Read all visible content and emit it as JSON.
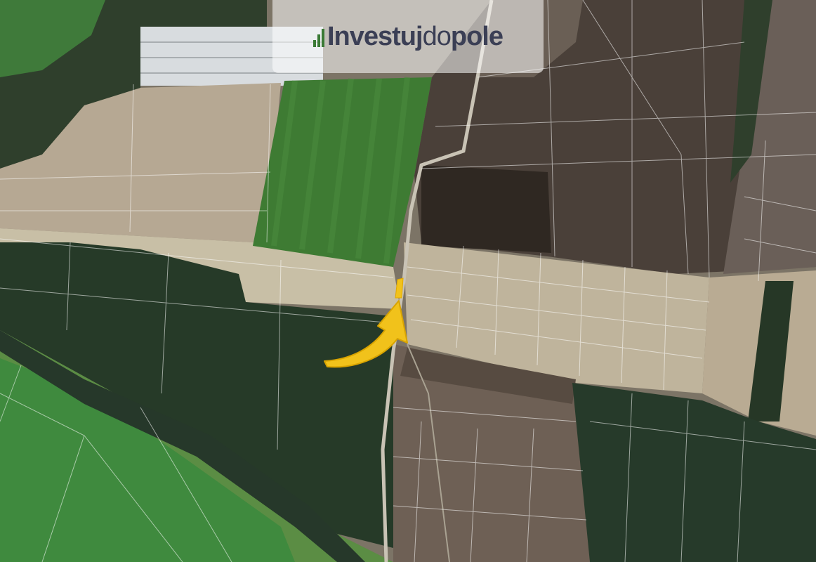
{
  "watermark": {
    "brand_part1": "Investuj",
    "brand_part2": "do",
    "brand_part3": "pole"
  },
  "map": {
    "highlight_color": "#f1c21b",
    "arrow_color": "#f1c21b",
    "parcel_line_color": "#ffffff",
    "field_colors": {
      "stubble": "#b8ab93",
      "green_crop": "#3f7d35",
      "plowed": "#4b4038",
      "forest": "#2a3a2a",
      "meadow": "#5c8e45"
    }
  }
}
